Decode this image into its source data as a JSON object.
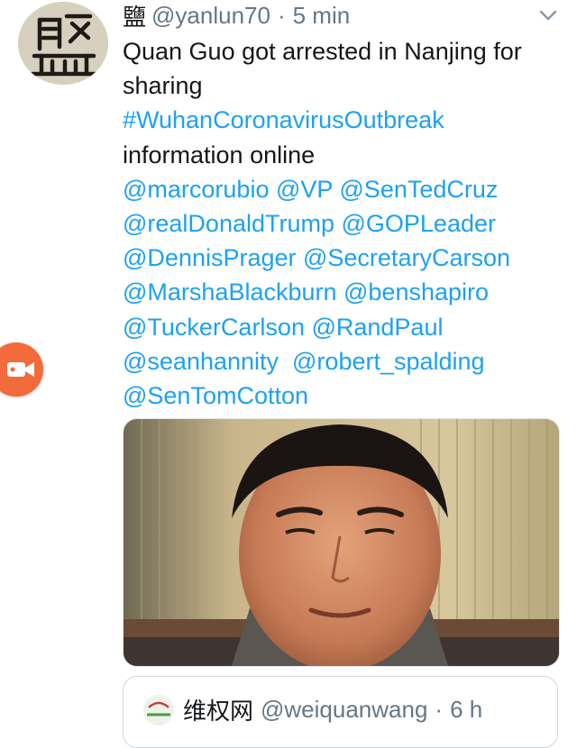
{
  "tweet": {
    "display_name": "鹽",
    "handle": "@yanlun70",
    "separator": "·",
    "time": "5 min",
    "lines": [
      {
        "text": "Quan Guo got arrested in Nanjing for",
        "link": false
      },
      {
        "text": "sharing",
        "link": false
      },
      {
        "text": "#WuhanCoronavirusOutbreak",
        "link": true
      },
      {
        "text": "information online",
        "link": false
      },
      {
        "text": "@marcorubio @VP @SenTedCruz",
        "link": true
      },
      {
        "text": "@realDonaldTrump @GOPLeader",
        "link": true
      },
      {
        "text": "@DennisPrager @SecretaryCarson",
        "link": true
      },
      {
        "text": "@MarshaBlackburn @benshapiro",
        "link": true
      },
      {
        "text": "@TuckerCarlson @RandPaul",
        "link": true
      },
      {
        "text": "@seanhannity  @robert_spalding",
        "link": true
      },
      {
        "text": "@SenTomCotton",
        "link": true
      }
    ]
  },
  "quoted_tweet": {
    "display_name": "维权网",
    "handle": "@weiquanwang",
    "separator": "·",
    "time": "6 h"
  },
  "colors": {
    "link": "#1da1f2",
    "meta": "#657786",
    "text": "#14171a",
    "record_button": "#f26b3a"
  },
  "icons": {
    "more": "chevron-down-icon",
    "record": "video-camera-icon"
  }
}
